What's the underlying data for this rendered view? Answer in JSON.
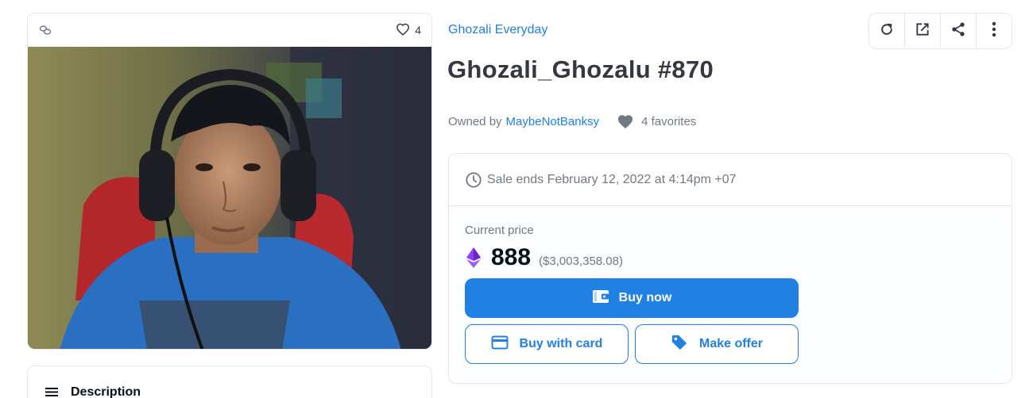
{
  "media": {
    "favorites_count": "4",
    "icons": {
      "chain": "ethereum-chain-icon",
      "heart": "heart-outline-icon"
    }
  },
  "description": {
    "label": "Description"
  },
  "collection": {
    "name": "Ghozali Everyday"
  },
  "toolbar": {
    "icons": [
      "refresh-icon",
      "external-link-icon",
      "share-icon",
      "more-options-icon"
    ]
  },
  "item": {
    "title": "Ghozali_Ghozalu #870"
  },
  "owner": {
    "prefix": "Owned by",
    "name": "MaybeNotBanksy",
    "favorites_text": "4 favorites"
  },
  "sale": {
    "ends_text": "Sale ends February 12, 2022 at 4:14pm +07"
  },
  "price": {
    "label": "Current price",
    "value": "888",
    "usd": "($3,003,358.08)"
  },
  "actions": {
    "buy_now": "Buy now",
    "buy_with_card": "Buy with card",
    "make_offer": "Make offer"
  },
  "colors": {
    "accent": "#2081e2",
    "text": "#353840",
    "muted": "#707a83",
    "border": "#e5e8eb"
  }
}
